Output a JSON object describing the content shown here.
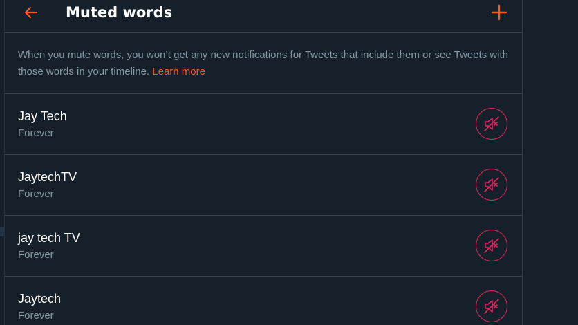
{
  "header": {
    "title": "Muted words",
    "back_icon": "arrow-left-icon",
    "add_icon": "plus-icon"
  },
  "description": {
    "text": "When you mute words, you won’t get any new notifications for Tweets that include them or see Tweets with those words in your timeline.",
    "link": "Learn more"
  },
  "muted_words": [
    {
      "word": "Jay Tech",
      "duration": "Forever"
    },
    {
      "word": "JaytechTV",
      "duration": "Forever"
    },
    {
      "word": "jay tech TV",
      "duration": "Forever"
    },
    {
      "word": "Jaytech",
      "duration": "Forever"
    }
  ],
  "colors": {
    "background": "#15202b",
    "accent": "#f45d22",
    "unmute": "#e0245e",
    "secondary_text": "#8899a6",
    "border": "#38444d"
  }
}
